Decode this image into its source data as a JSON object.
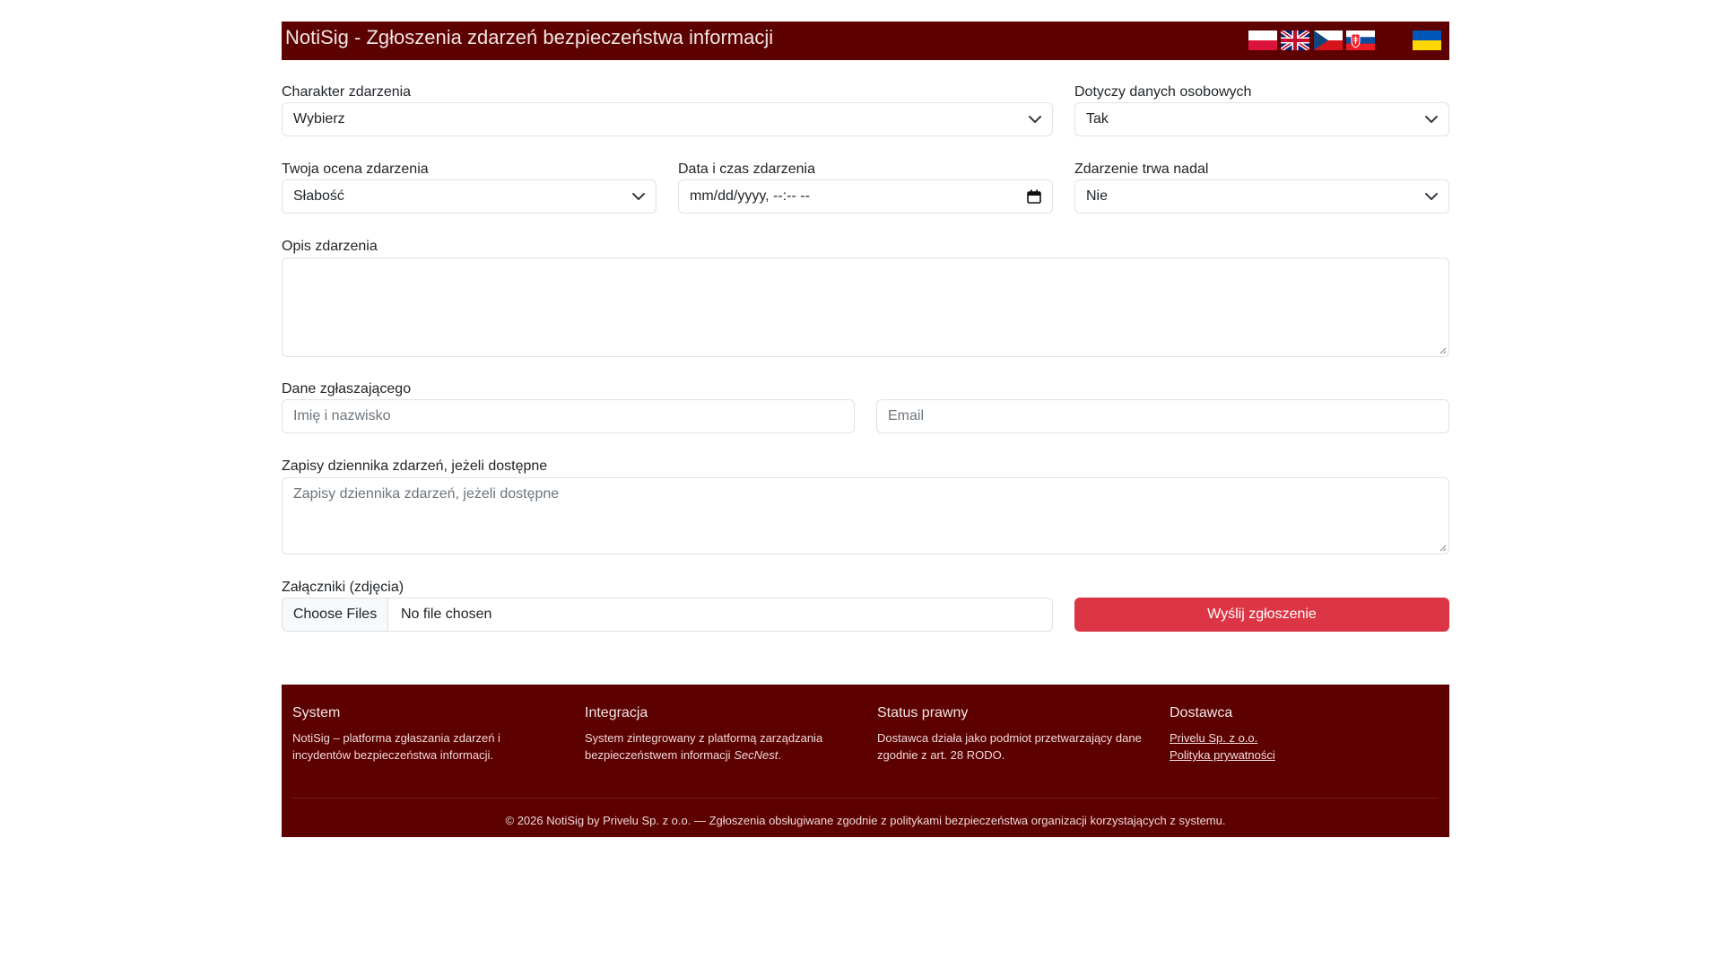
{
  "header": {
    "title": "NotiSig - Zgłoszenia zdarzeń bezpieczeństwa informacji",
    "languages": [
      {
        "code": "pl",
        "icon": "poland-flag-icon"
      },
      {
        "code": "en",
        "icon": "uk-flag-icon"
      },
      {
        "code": "cs",
        "icon": "czech-flag-icon"
      },
      {
        "code": "sk",
        "icon": "slovakia-flag-icon"
      },
      {
        "code": "uk",
        "icon": "ukraine-flag-icon"
      }
    ]
  },
  "form": {
    "charakter": {
      "label": "Charakter zdarzenia",
      "value": "Wybierz"
    },
    "dane_osobowe": {
      "label": "Dotyczy danych osobowych",
      "value": "Tak"
    },
    "ocena": {
      "label": "Twoja ocena zdarzenia",
      "value": "Słabość"
    },
    "data_czas": {
      "label": "Data i czas zdarzenia",
      "value": "mm/dd/yyyy, --:-- --"
    },
    "trwa_nadal": {
      "label": "Zdarzenie trwa nadal",
      "value": "Nie"
    },
    "opis": {
      "label": "Opis zdarzenia",
      "placeholder": ""
    },
    "zglaszajacy": {
      "label": "Dane zgłaszającego",
      "name_placeholder": "Imię i nazwisko",
      "email_placeholder": "Email"
    },
    "dziennik": {
      "label": "Zapisy dziennika zdarzeń, jeżeli dostępne",
      "placeholder": "Zapisy dziennika zdarzeń, jeżeli dostępne"
    },
    "zalaczniki": {
      "label": "Załączniki (zdjęcia)",
      "button": "Choose Files",
      "status": "No file chosen"
    },
    "submit": "Wyślij zgłoszenie"
  },
  "footer": {
    "system": {
      "title": "System",
      "text": "NotiSig – platforma zgłaszania zdarzeń i incydentów bezpieczeństwa informacji."
    },
    "integracja": {
      "title": "Integracja",
      "text_before": "System zintegrowany z platformą zarządzania bezpieczeństwem informacji ",
      "text_em": "SecNest",
      "text_after": "."
    },
    "status": {
      "title": "Status prawny",
      "text": "Dostawca działa jako podmiot przetwarzający dane zgodnie z art. 28 RODO."
    },
    "dostawca": {
      "title": "Dostawca",
      "link1": "Privelu Sp. z o.o.",
      "link2": "Polityka prywatności"
    },
    "copyright": "© 2026 NotiSig by Privelu Sp. z o.o. — Zgłoszenia obsługiwane zgodnie z politykami bezpieczeństwa organizacji korzystających z systemu."
  },
  "colors": {
    "brand": "#5c0000",
    "danger": "#dc3545",
    "border": "#dee2e6"
  }
}
